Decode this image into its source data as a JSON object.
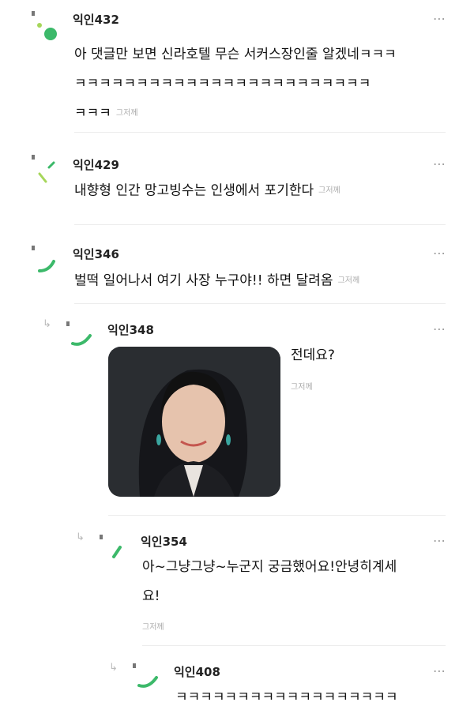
{
  "comments": [
    {
      "author": "익인432",
      "lines": [
        "아 댓글만 보면 신라호텔 무슨 서커스장인줄 알겠네ㅋㅋㅋ",
        "ㅋㅋㅋㅋㅋㅋㅋㅋㅋㅋㅋㅋㅋㅋㅋㅋㅋㅋㅋㅋㅋㅋㅋㅋ",
        "ㅋㅋㅋ"
      ],
      "time": "그저께"
    },
    {
      "author": "익인429",
      "lines": [
        "내향형 인간 망고빙수는 인생에서 포기한다"
      ],
      "time": "그저께"
    },
    {
      "author": "익인346",
      "lines": [
        "벌떡 일어나서 여기 사장 누구야!! 하면 달려옴"
      ],
      "time": "그저께"
    },
    {
      "author": "익인348",
      "lines": [
        "전데요?"
      ],
      "time": "그저께"
    },
    {
      "author": "익인354",
      "lines": [
        "아~그냥그냥~누군지 궁금했어요!안녕히계세",
        "요!"
      ],
      "time": "그저께"
    },
    {
      "author": "익인408",
      "lines": [
        "ㅋㅋㅋㅋㅋㅋㅋㅋㅋㅋㅋㅋㅋㅋㅋㅋㅋㅋ"
      ],
      "time": ""
    }
  ],
  "ui": {
    "more_icon": "⋯",
    "reply_icon": "↳"
  },
  "colors": {
    "accent": "#3cb96a",
    "accent_light": "#a6d65a"
  }
}
